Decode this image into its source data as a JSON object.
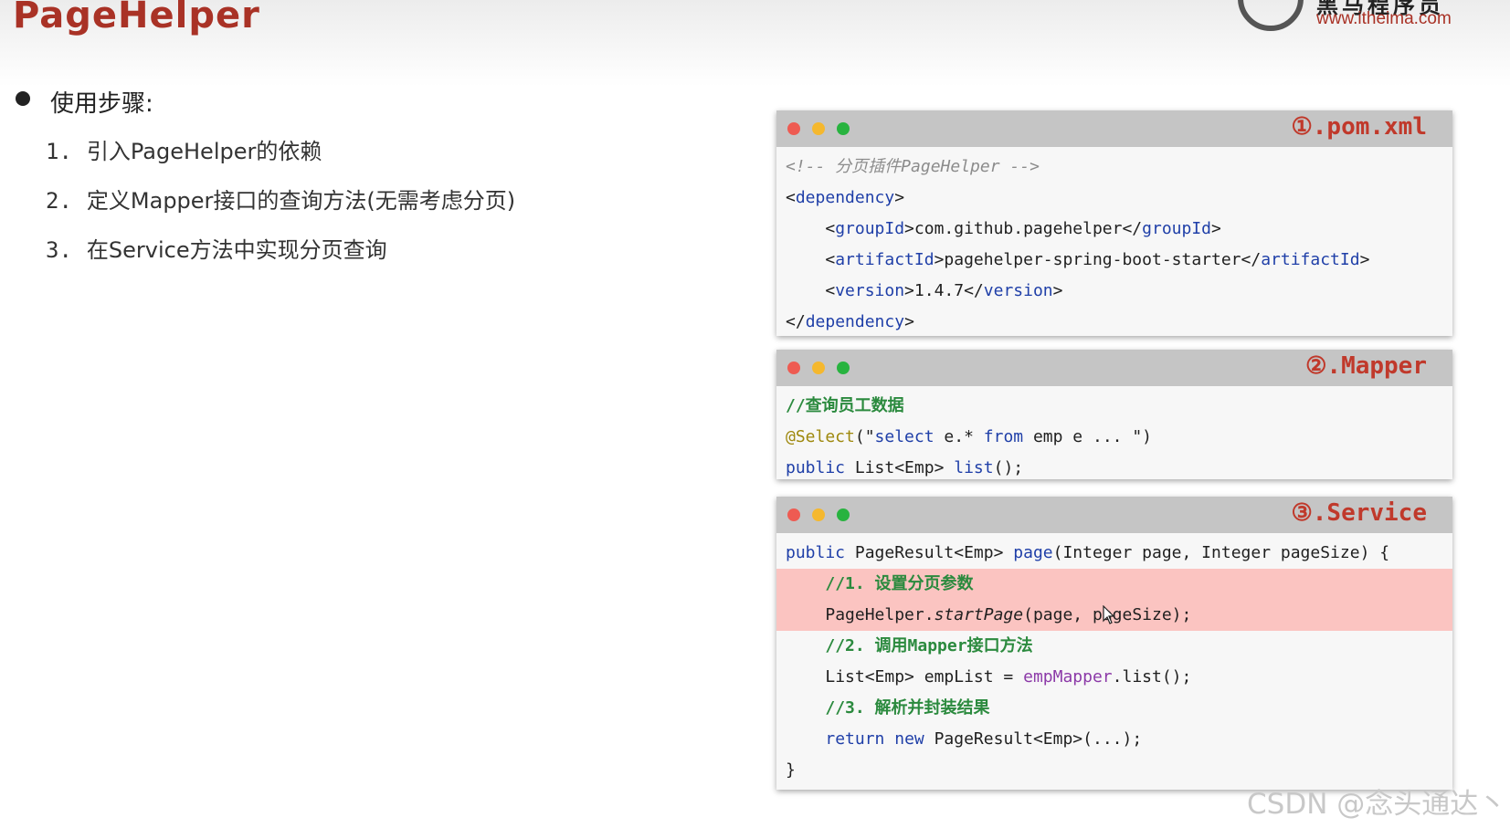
{
  "slide": {
    "title": "PageHelper",
    "logo": {
      "name": "黑马程序员",
      "url": "www.itheima.com"
    },
    "heading": "使用步骤:",
    "steps": [
      {
        "num": "1.",
        "text": "引入PageHelper的依赖"
      },
      {
        "num": "2.",
        "text": "定义Mapper接口的查询方法(无需考虑分页)"
      },
      {
        "num": "3.",
        "text": "在Service方法中实现分页查询"
      }
    ]
  },
  "panels": {
    "pom": {
      "title": "①.pom.xml",
      "lines": {
        "comment": "<!-- 分页插件PageHelper -->",
        "dependency_open_tag": "dependency",
        "group_tag": "groupId",
        "group_value": "com.github.pagehelper",
        "artifact_tag": "artifactId",
        "artifact_value": "pagehelper-spring-boot-starter",
        "version_tag": "version",
        "version_value": "1.4.7",
        "dependency_close_tag": "dependency"
      }
    },
    "mapper": {
      "title": "②.Mapper",
      "comment": "//查询员工数据",
      "annotation": "@Select",
      "sql_kw1": "select",
      "sql_mid": " e.* ",
      "sql_kw2": "from",
      "sql_tail": " emp e ... ",
      "public_kw": "public",
      "return_type": " List<Emp> ",
      "method": "list",
      "suffix": "();"
    },
    "service": {
      "title": "③.Service",
      "sig_public": "public",
      "sig_type": " PageResult<Emp> ",
      "sig_method": "page",
      "sig_params": "(Integer page, Integer pageSize) {",
      "comment1": "//1. 设置分页参数",
      "call_obj": "PageHelper.",
      "call_method": "startPage",
      "call_args": "(page, pageSize);",
      "comment2": "//2. 调用Mapper接口方法",
      "list_decl": "List<Emp> empList = ",
      "list_field": "empMapper",
      "list_call": ".list();",
      "comment3": "//3. 解析并封装结果",
      "return_kw": "return",
      "new_kw": "new",
      "return_rest": " PageResult<Emp>(...);",
      "close": "}"
    }
  },
  "watermark": "CSDN @念头通达丶",
  "colors": {
    "title": "#a93226",
    "panel_bar": "#c5c5c5",
    "highlight": "#fbc4c1",
    "comment_green": "#2b8a3e",
    "keyword_blue": "#1f3fa8"
  },
  "icons": [
    "mac-close-dot",
    "mac-minimize-dot",
    "mac-maximize-dot",
    "mouse-cursor-icon",
    "itheima-logo-icon"
  ]
}
